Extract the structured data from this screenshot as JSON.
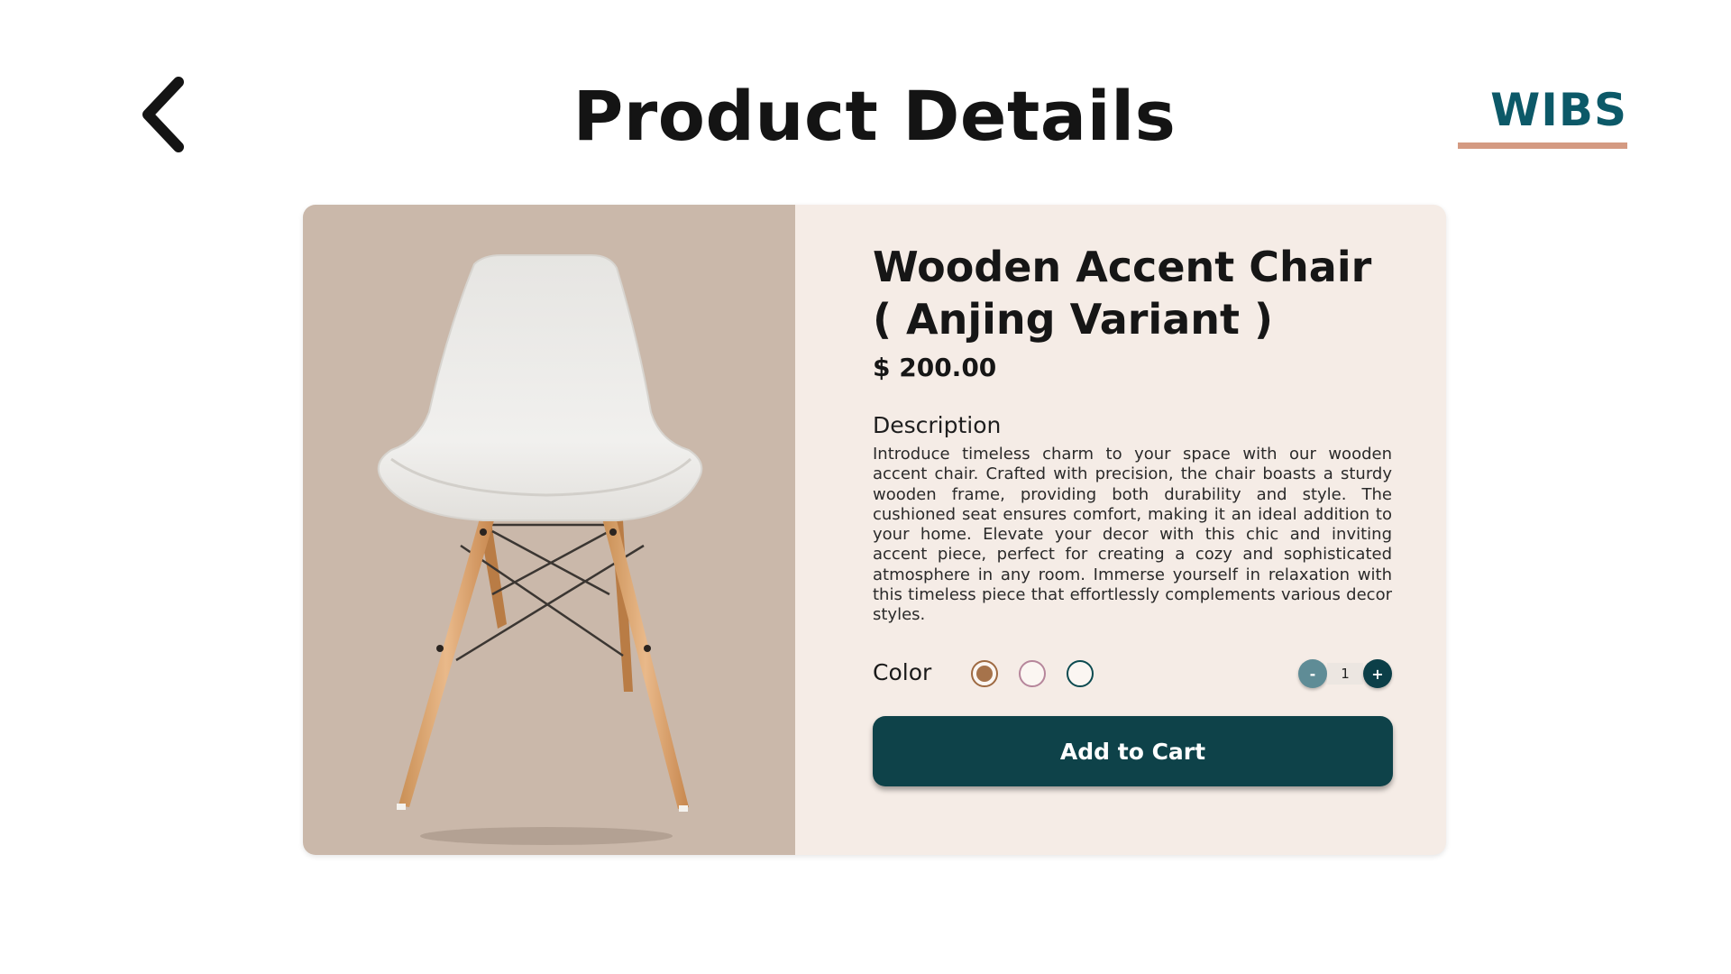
{
  "header": {
    "title": "Product Details",
    "back_icon": "chevron-left-icon",
    "logo_text": "WIBS"
  },
  "product": {
    "name_line1": "Wooden Accent Chair",
    "name_line2": "( Anjing Variant )",
    "price": "$ 200.00",
    "description_heading": "Description",
    "description": "Introduce timeless charm to your space with our wooden accent chair. Crafted with precision, the chair boasts a sturdy wooden frame, providing both durability and style. The cushioned seat ensures comfort, making it an ideal addition to your home. Elevate your decor with this chic and inviting accent piece, perfect for creating a cozy and sophisticated atmosphere in any room. Immerse yourself in relaxation with this timeless piece that effortlessly complements various decor styles.",
    "image_icon": "chair-image"
  },
  "options": {
    "color_label": "Color",
    "colors": [
      {
        "name": "brown",
        "hex": "#a6734b",
        "selected": true
      },
      {
        "name": "pink",
        "hex": "#b6869b",
        "selected": false
      },
      {
        "name": "teal",
        "hex": "#0c4a50",
        "selected": false
      }
    ],
    "quantity": "1",
    "minus_label": "-",
    "plus_label": "+"
  },
  "actions": {
    "add_to_cart_label": "Add to Cart"
  },
  "colors": {
    "brand": "#0c5968",
    "accent": "#d49a82",
    "card_bg": "#f5ece6",
    "image_bg": "#cab8aa",
    "button_bg": "#0e4249"
  }
}
